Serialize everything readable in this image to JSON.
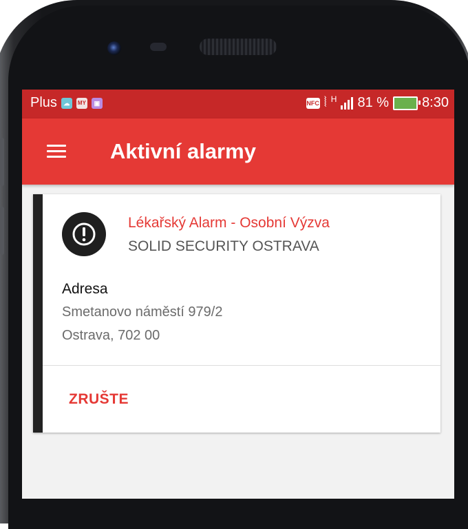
{
  "status_bar": {
    "carrier": "Plus",
    "nfc_label": "NFC",
    "network_type": "H",
    "battery_percent": "81 %",
    "time": "8:30"
  },
  "app_bar": {
    "title": "Aktivní alarmy",
    "menu_icon": "hamburger-menu-icon"
  },
  "alarm": {
    "icon": "exclamation-circle-icon",
    "type": "Lékařský Alarm - Osobní Výzva",
    "company": "SOLID SECURITY OSTRAVA",
    "address_label": "Adresa",
    "address_line1": "Smetanovo náměstí 979/2",
    "address_line2": "Ostrava, 702 00",
    "cancel_label": "ZRUŠTE"
  },
  "colors": {
    "status_bar": "#c62828",
    "app_bar": "#e53935",
    "accent": "#e53935",
    "card_stripe": "#222222"
  }
}
